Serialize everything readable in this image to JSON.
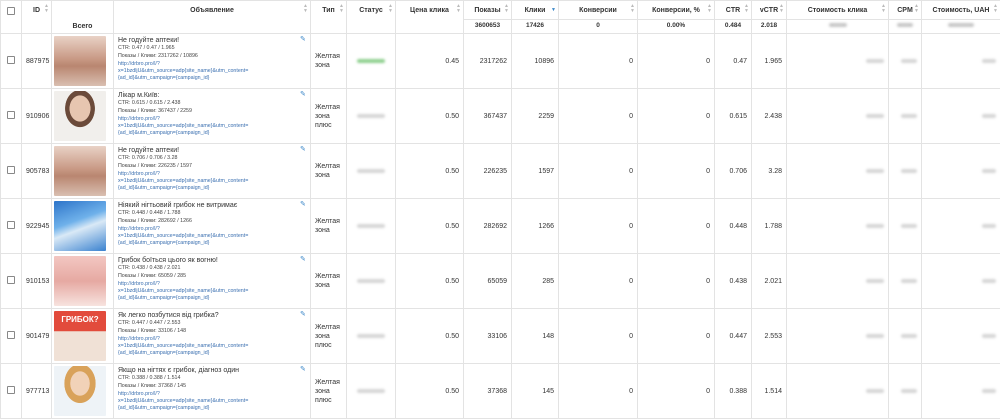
{
  "header": {
    "id": "ID",
    "all": "Всего",
    "ad": "Объявление",
    "type": "Тип",
    "status": "Статус",
    "click_price": "Цена клика",
    "impressions": "Показы",
    "clicks": "Клики",
    "conversions": "Конверсии",
    "conv_pct": "Конверсии, %",
    "ctr": "CTR",
    "vctr": "vCTR",
    "click_cost": "Стоимость клика",
    "cpm": "CPM",
    "cost": "Стоимость, UAH"
  },
  "totals": {
    "impressions": "3600653",
    "clicks": "17426",
    "conversions": "0",
    "conv_pct": "0.00%",
    "ctr": "0.484",
    "vctr": "2.018"
  },
  "rows": [
    {
      "id": "887975",
      "title": "Не годуйте аптеки!",
      "meta1": "CTR: 0.47 / 0.47 / 1.965",
      "meta2": "Показы / Клики: 2317262 / 10896",
      "link1": "http://drbro.pro/l/?",
      "link2": "x=1bzdljU&utm_source=adp{site_name}&utm_content=",
      "link3": "{ad_id}&utm_campaign={campaign_id}",
      "type": "Желтая зона",
      "price": "0.45",
      "impressions": "2317262",
      "clicks": "10896",
      "conversions": "0",
      "conv_pct": "0",
      "ctr": "0.47",
      "vctr": "1.965",
      "thumb": "feet",
      "status": "green"
    },
    {
      "id": "910906",
      "title": "Лікар м.Київ:",
      "meta1": "CTR: 0.615 / 0.615 / 2.438",
      "meta2": "Показы / Клики: 367437 / 2259",
      "link1": "http://drbro.pro/l/?",
      "link2": "x=1bzdljU&utm_source=adp{site_name}&utm_content=",
      "link3": "{ad_id}&utm_campaign={campaign_id}",
      "type": "Желтая зона плюс",
      "price": "0.50",
      "impressions": "367437",
      "clicks": "2259",
      "conversions": "0",
      "conv_pct": "0",
      "ctr": "0.615",
      "vctr": "2.438",
      "thumb": "portrait",
      "status": "grey"
    },
    {
      "id": "905783",
      "title": "Не годуйте аптеки!",
      "meta1": "CTR: 0.706 / 0.706 / 3.28",
      "meta2": "Показы / Клики: 226235 / 1597",
      "link1": "http://drbro.pro/l/?",
      "link2": "x=1bzdljU&utm_source=adp{site_name}&utm_content=",
      "link3": "{ad_id}&utm_campaign={campaign_id}",
      "type": "Желтая зона",
      "price": "0.50",
      "impressions": "226235",
      "clicks": "1597",
      "conversions": "0",
      "conv_pct": "0",
      "ctr": "0.706",
      "vctr": "3.28",
      "thumb": "feet",
      "status": "grey"
    },
    {
      "id": "922945",
      "title": "Ніякий нігтьовий грибок не витримає",
      "meta1": "CTR: 0.448 / 0.448 / 1.788",
      "meta2": "Показы / Клики: 282692 / 1266",
      "link1": "http://drbro.pro/l/?",
      "link2": "x=1bzdljU&utm_source=adp{site_name}&utm_content=",
      "link3": "{ad_id}&utm_campaign={campaign_id}",
      "type": "Желтая зона",
      "price": "0.50",
      "impressions": "282692",
      "clicks": "1266",
      "conversions": "0",
      "conv_pct": "0",
      "ctr": "0.448",
      "vctr": "1.788",
      "thumb": "blue",
      "status": "grey"
    },
    {
      "id": "910153",
      "title": "Грибок боїться цього як вогню!",
      "meta1": "CTR: 0.438 / 0.438 / 2.021",
      "meta2": "Показы / Клики: 65059 / 285",
      "link1": "http://drbro.pro/l/?",
      "link2": "x=1bzdljU&utm_source=adp{site_name}&utm_content=",
      "link3": "{ad_id}&utm_campaign={campaign_id}",
      "type": "Желтая зона",
      "price": "0.50",
      "impressions": "65059",
      "clicks": "285",
      "conversions": "0",
      "conv_pct": "0",
      "ctr": "0.438",
      "vctr": "2.021",
      "thumb": "pink",
      "status": "grey"
    },
    {
      "id": "901479",
      "title": "Як легко позбутися від грибка?",
      "meta1": "CTR: 0.447 / 0.447 / 2.553",
      "meta2": "Показы / Клики: 33106 / 148",
      "link1": "http://drbro.pro/l/?",
      "link2": "x=1bzdljU&utm_source=adp{site_name}&utm_content=",
      "link3": "{ad_id}&utm_campaign={campaign_id}",
      "type": "Желтая зона плюс",
      "price": "0.50",
      "impressions": "33106",
      "clicks": "148",
      "conversions": "0",
      "conv_pct": "0",
      "ctr": "0.447",
      "vctr": "2.553",
      "thumb": "red",
      "thumb_text": "ГРИБОК?",
      "status": "grey"
    },
    {
      "id": "977713",
      "title": "Якщо на нігтях є грибок, діагноз один",
      "meta1": "CTR: 0.388 / 0.388 / 1.514",
      "meta2": "Показы / Клики: 37368 / 145",
      "link1": "http://drbro.pro/l/?",
      "link2": "x=1bzdljU&utm_source=adp{site_name}&utm_content=",
      "link3": "{ad_id}&utm_campaign={campaign_id}",
      "type": "Желтая зона плюс",
      "price": "0.50",
      "impressions": "37368",
      "clicks": "145",
      "conversions": "0",
      "conv_pct": "0",
      "ctr": "0.388",
      "vctr": "1.514",
      "thumb": "portrait2",
      "status": "grey"
    }
  ],
  "colors": {
    "link": "#3a6fb0",
    "accent": "#3a87c8",
    "status_active": "#8fd08f"
  },
  "icons": {
    "edit": "edit-icon",
    "sort": "sort-icon",
    "sort_active": "sort-down-icon"
  }
}
